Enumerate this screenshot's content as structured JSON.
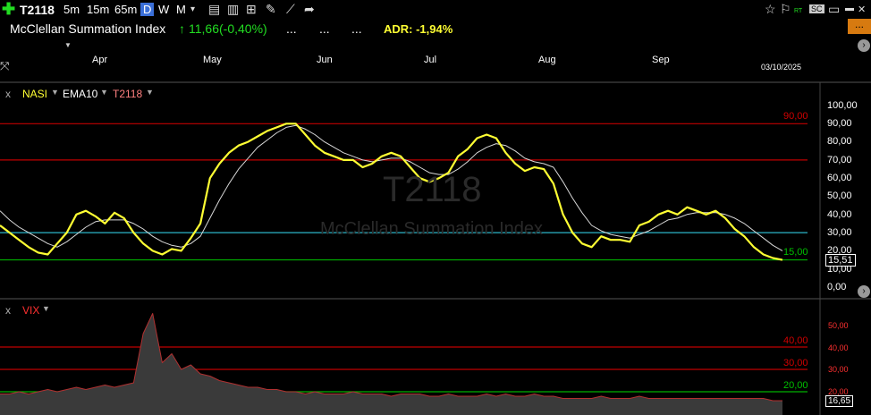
{
  "toolbar": {
    "symbol": "T2118",
    "timeframes": [
      "5m",
      "15m",
      "65m",
      "D",
      "W",
      "M"
    ],
    "active_timeframe": "D",
    "badge_rt": "RT",
    "badge_sc": "SC"
  },
  "header": {
    "title": "McClellan Summation Index",
    "change": "11,66(-0,40%)",
    "dots1": "...",
    "dots2": "...",
    "dots3": "...",
    "adr": "ADR: -1,94%",
    "menu_button": "..."
  },
  "x_axis": {
    "months": [
      "Apr",
      "May",
      "Jun",
      "Jul",
      "Aug",
      "Sep"
    ],
    "date": "03/10/2025"
  },
  "main_panel": {
    "close_x": "x",
    "labels": [
      "NASI",
      "EMA10",
      "T2118"
    ],
    "watermark_symbol": "T2118",
    "watermark_name": "McClellan Summation Index",
    "y_ticks": [
      "100,00",
      "90,00",
      "80,00",
      "70,00",
      "60,00",
      "50,00",
      "40,00",
      "30,00",
      "20,00",
      "10,00",
      "0,00"
    ],
    "level_90": "90,00",
    "level_15": "15,00",
    "last_value": "15,51"
  },
  "vix_panel": {
    "close_x": "x",
    "label": "VIX",
    "y_ticks": [
      "50,00",
      "40,00",
      "30,00",
      "20,00"
    ],
    "level_40": "40,00",
    "level_30": "30,00",
    "level_20": "20,00",
    "last_value": "16,65"
  },
  "colors": {
    "nasi": "#ffff33",
    "ema": "#d8d8d8",
    "red_line": "#c00000",
    "cyan_line": "#2bb5c8",
    "green_line": "#00b000",
    "up_green": "#22dd22",
    "adr_yellow": "#ffff33"
  },
  "chart_data": {
    "type": "line",
    "series": [
      {
        "name": "NASI",
        "values": [
          34,
          30,
          26,
          22,
          19,
          18,
          24,
          30,
          40,
          42,
          39,
          35,
          41,
          38,
          30,
          24,
          20,
          18,
          21,
          20,
          27,
          35,
          60,
          68,
          74,
          78,
          80,
          83,
          86,
          88,
          90,
          90,
          84,
          78,
          74,
          72,
          70,
          70,
          66,
          68,
          72,
          74,
          72,
          66,
          60,
          58,
          60,
          63,
          72,
          76,
          82,
          84,
          82,
          74,
          68,
          64,
          66,
          65,
          57,
          40,
          30,
          24,
          22,
          28,
          26,
          26,
          25,
          34,
          36,
          40,
          42,
          40,
          44,
          42,
          40,
          42,
          38,
          32,
          28,
          22,
          18,
          16,
          15
        ]
      },
      {
        "name": "EMA10",
        "values": [
          42,
          37,
          33,
          30,
          27,
          24,
          22,
          25,
          29,
          33,
          36,
          37,
          37,
          37,
          35,
          32,
          28,
          25,
          23,
          22,
          24,
          28,
          38,
          48,
          57,
          65,
          71,
          77,
          81,
          85,
          88,
          89,
          87,
          84,
          80,
          77,
          74,
          72,
          70,
          69,
          70,
          71,
          71,
          69,
          66,
          63,
          62,
          62,
          65,
          69,
          74,
          77,
          79,
          78,
          75,
          71,
          69,
          68,
          66,
          58,
          49,
          41,
          34,
          31,
          29,
          28,
          27,
          29,
          31,
          34,
          37,
          38,
          40,
          41,
          41,
          41,
          40,
          38,
          35,
          31,
          27,
          23,
          20
        ]
      },
      {
        "name": "VIX",
        "values": [
          19,
          19,
          20,
          19,
          20,
          21,
          20,
          21,
          22,
          21,
          22,
          23,
          22,
          23,
          24,
          46,
          55,
          33,
          37,
          30,
          32,
          28,
          27,
          25,
          24,
          23,
          22,
          22,
          21,
          21,
          20,
          20,
          19,
          20,
          19,
          19,
          19,
          20,
          19,
          19,
          19,
          18,
          19,
          19,
          19,
          18,
          18,
          19,
          18,
          18,
          18,
          19,
          18,
          19,
          18,
          18,
          19,
          18,
          18,
          17,
          17,
          17,
          17,
          18,
          17,
          17,
          17,
          18,
          17,
          17,
          17,
          17,
          17,
          17,
          17,
          17,
          17,
          17,
          17,
          17,
          17,
          16,
          16
        ]
      }
    ],
    "ylim_main": [
      0,
      100
    ],
    "ylim_vix": [
      15,
      55
    ],
    "reference_lines_main": [
      90,
      70,
      30,
      15
    ],
    "reference_lines_vix": [
      40,
      30,
      20
    ]
  }
}
